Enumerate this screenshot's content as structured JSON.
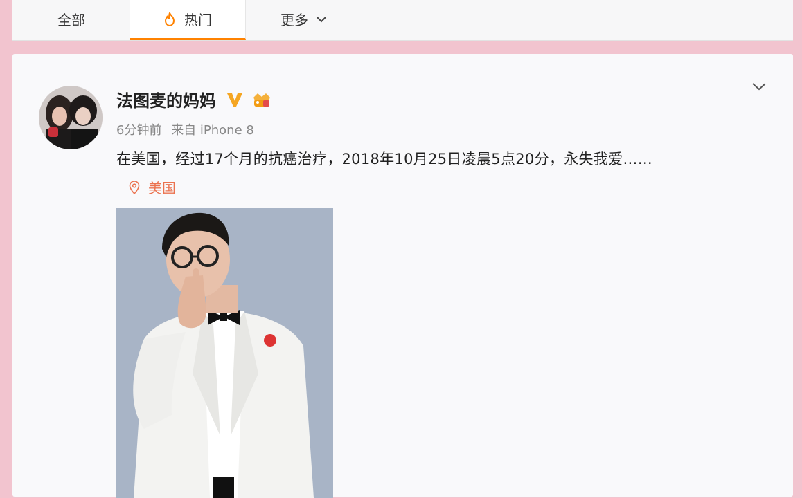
{
  "tabs": [
    {
      "label": "全部"
    },
    {
      "label": "热门",
      "icon": "flame-icon"
    },
    {
      "label": "更多",
      "icon": "chevron-down-icon"
    }
  ],
  "post": {
    "username": "法图麦的妈妈",
    "verified_icon": "verified-v-icon",
    "level_icon": "member-badge-icon",
    "time": "6分钟前",
    "source": "来自 iPhone 8",
    "text": "在美国，经过17个月的抗癌治疗，2018年10月25日凌晨5点20分，永失我爱……",
    "location": "美国",
    "more_icon": "chevron-down-icon"
  },
  "colors": {
    "accent": "#ff8200",
    "location": "#eb7350",
    "verified": "#f5a623",
    "page_bg": "#f2c4cf"
  }
}
